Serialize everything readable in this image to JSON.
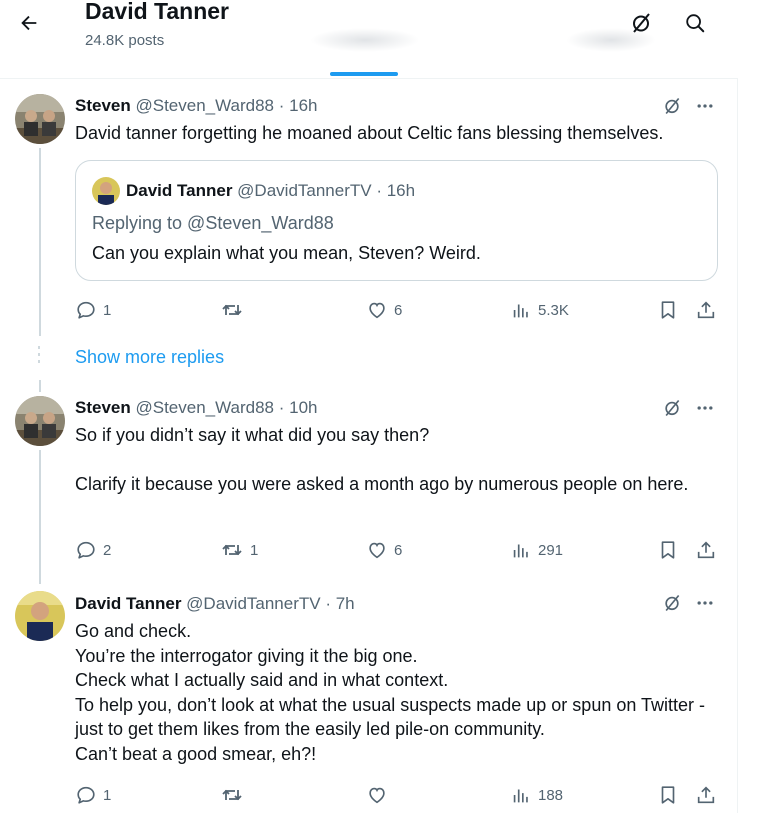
{
  "header": {
    "title": "David Tanner",
    "subtitle": "24.8K posts"
  },
  "posts": [
    {
      "name": "Steven",
      "handle": "@Steven_Ward88",
      "time": "· 16h",
      "text": "David tanner forgetting he moaned about Celtic fans blessing themselves.",
      "quote": {
        "name": "David Tanner",
        "handle": "@DavidTannerTV",
        "time": "· 16h",
        "replying": "Replying to @Steven_Ward88",
        "text": "Can you explain what you mean, Steven? Weird."
      },
      "replies": "1",
      "reposts": "",
      "likes": "6",
      "views": "5.3K"
    },
    {
      "name": "Steven",
      "handle": "@Steven_Ward88",
      "time": "· 10h",
      "text": "So if you didn’t say it what did you say then?\n\nClarify it because you were asked a month ago by numerous people on here.",
      "replies": "2",
      "reposts": "1",
      "likes": "6",
      "views": "291"
    },
    {
      "name": "David Tanner",
      "handle": "@DavidTannerTV",
      "time": "· 7h",
      "text": "Go and check.\nYou’re the interrogator giving it the big one.\nCheck what I actually said and in what context.\nTo help you, don’t look at what the usual suspects made up or spun on Twitter - just to get them likes from the easily led pile-on community.\nCan’t beat a good smear, eh?!",
      "replies": "1",
      "reposts": "",
      "likes": "",
      "views": "188"
    }
  ],
  "show_more_label": "Show more replies",
  "colors": {
    "accent": "#1d9bf0",
    "text": "#0f1419",
    "muted": "#536471",
    "border": "#cfd9de"
  }
}
